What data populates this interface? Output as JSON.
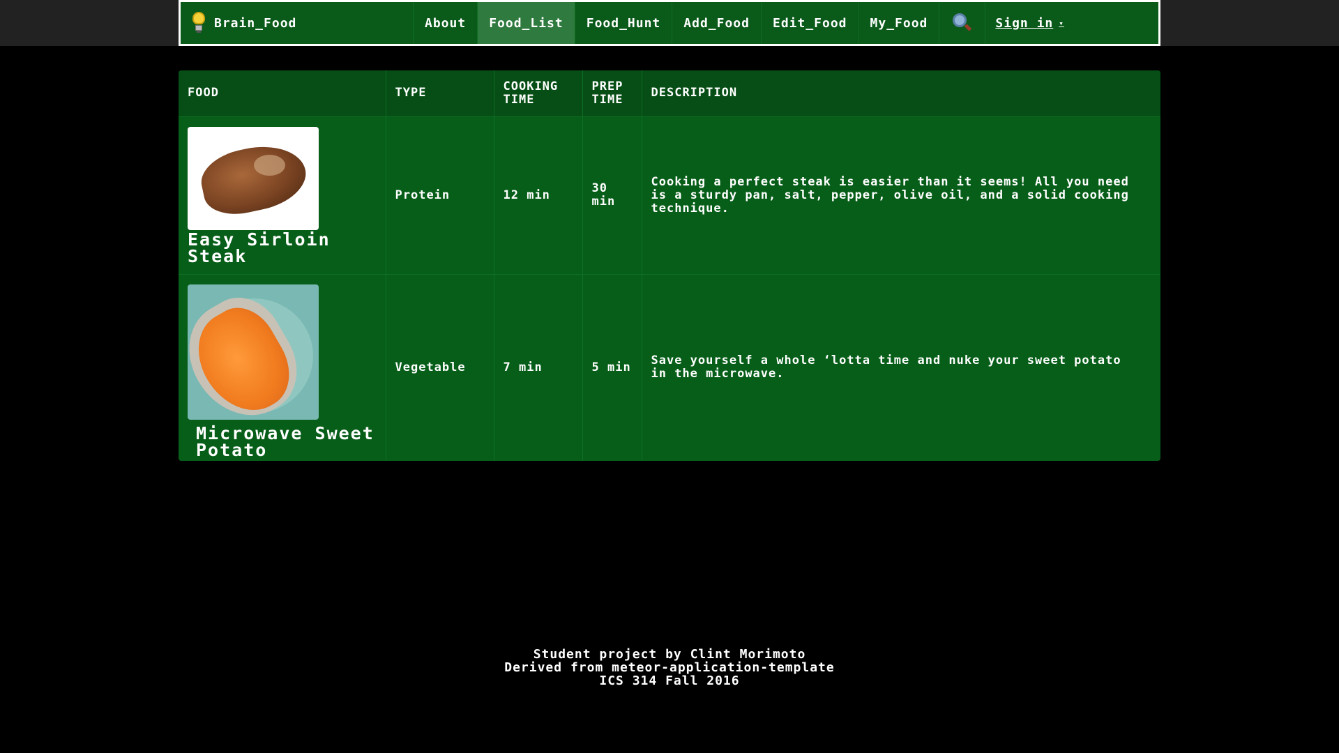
{
  "nav": {
    "brand": "Brain_Food",
    "items": [
      {
        "label": "About",
        "active": false
      },
      {
        "label": "Food_List",
        "active": true
      },
      {
        "label": "Food_Hunt",
        "active": false
      },
      {
        "label": "Add_Food",
        "active": false
      },
      {
        "label": "Edit_Food",
        "active": false
      },
      {
        "label": "My_Food",
        "active": false
      }
    ],
    "search_icon": "magnifier-icon",
    "signin": "Sign in",
    "signin_caret": "▾"
  },
  "table": {
    "headers": {
      "food": "FOOD",
      "type": "TYPE",
      "cooking_time": "COOKING TIME",
      "prep_time": "PREP TIME",
      "description": "DESCRIPTION"
    },
    "rows": [
      {
        "name": "Easy Sirloin Steak",
        "type": "Protein",
        "cooking_time": "12 min",
        "prep_time": "30 min",
        "description": "Cooking a perfect steak is easier than it seems! All you need is a sturdy pan, salt, pepper, olive oil, and a solid cooking technique."
      },
      {
        "name": "Microwave Sweet Potato",
        "type": "Vegetable",
        "cooking_time": "7 min",
        "prep_time": "5 min",
        "description": "Save yourself a whole ‘lotta time and nuke your sweet potato in the microwave."
      }
    ]
  },
  "footer": {
    "line1": "Student project by Clint Morimoto",
    "line2": "Derived from meteor-application-template",
    "line3": "ICS 314 Fall 2016"
  },
  "colors": {
    "navbar": "#0a5a1a",
    "active_tab": "#2f7a3e",
    "table_header": "#064e15",
    "table_body": "#075e19",
    "background": "#000000"
  }
}
